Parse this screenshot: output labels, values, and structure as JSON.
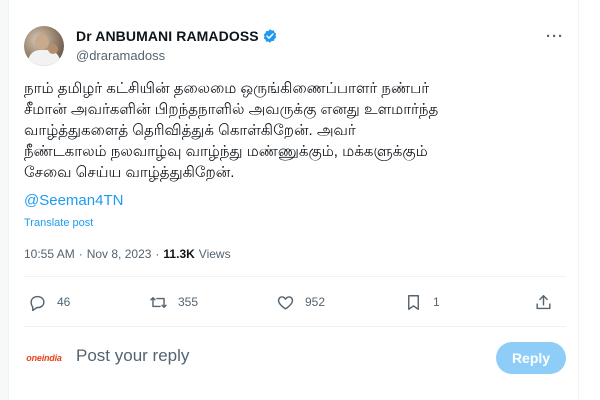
{
  "author": {
    "name": "Dr ANBUMANI RAMADOSS",
    "handle": "@draramadoss",
    "verified": true
  },
  "post": {
    "text": "நாம் தமிழர் கட்சியின் தலைமை ஒருங்கிணைப்பாளர் நண்பர்\nசீமான் அவர்களின் பிறந்தநாளில் அவருக்கு எனது உளமார்ந்த\nவாழ்த்துகளைத் தெரிவித்துக் கொள்கிறேன்.  அவர்\nநீண்டகாலம் நலவாழ்வு வாழ்ந்து மண்ணுக்கும், மக்களுக்கும்\nசேவை செய்ய வாழ்த்துகிறேன்.",
    "mention": "@Seeman4TN",
    "translate_label": "Translate post",
    "time": "10:55 AM",
    "separator": "·",
    "date": "Nov 8, 2023",
    "views_count": "11.3K",
    "views_label": "Views"
  },
  "actions": {
    "replies": "46",
    "reposts": "355",
    "likes": "952",
    "bookmarks": "1"
  },
  "reply_box": {
    "avatar_brand": "oneindia",
    "placeholder": "Post your reply",
    "button_label": "Reply"
  },
  "colors": {
    "accent": "#1d9bf0",
    "reply_button_disabled": "#8ecdf8",
    "secondary_text": "#536471"
  }
}
